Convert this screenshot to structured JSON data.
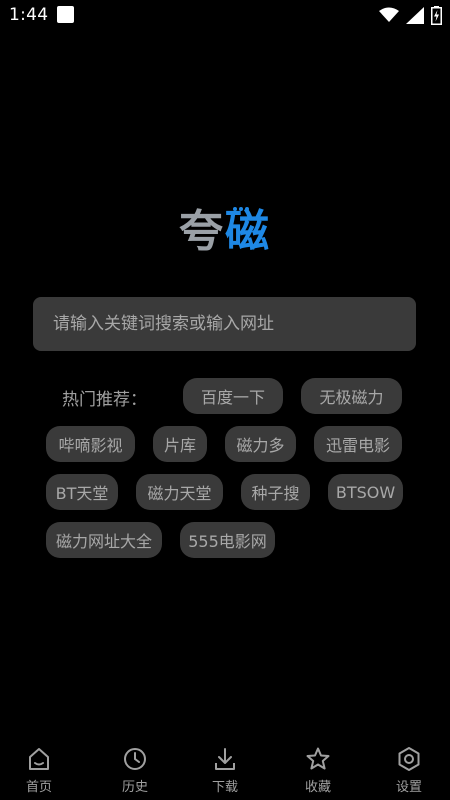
{
  "status": {
    "time": "1:44"
  },
  "logo": {
    "part1": "夸",
    "part2": "磁"
  },
  "search": {
    "placeholder": "请输入关键词搜索或输入网址"
  },
  "hot": {
    "label": "热门推荐：",
    "chips": [
      "百度一下",
      "无极磁力",
      "哔嘀影视",
      "片库",
      "磁力多",
      "迅雷电影",
      "BT天堂",
      "磁力天堂",
      "种子搜",
      "BTSOW",
      "磁力网址大全",
      "555电影网"
    ]
  },
  "nav": {
    "items": [
      {
        "label": "首页",
        "icon": "home-icon"
      },
      {
        "label": "历史",
        "icon": "clock-icon"
      },
      {
        "label": "下载",
        "icon": "download-icon"
      },
      {
        "label": "收藏",
        "icon": "star-icon"
      },
      {
        "label": "设置",
        "icon": "gear-icon"
      }
    ]
  }
}
